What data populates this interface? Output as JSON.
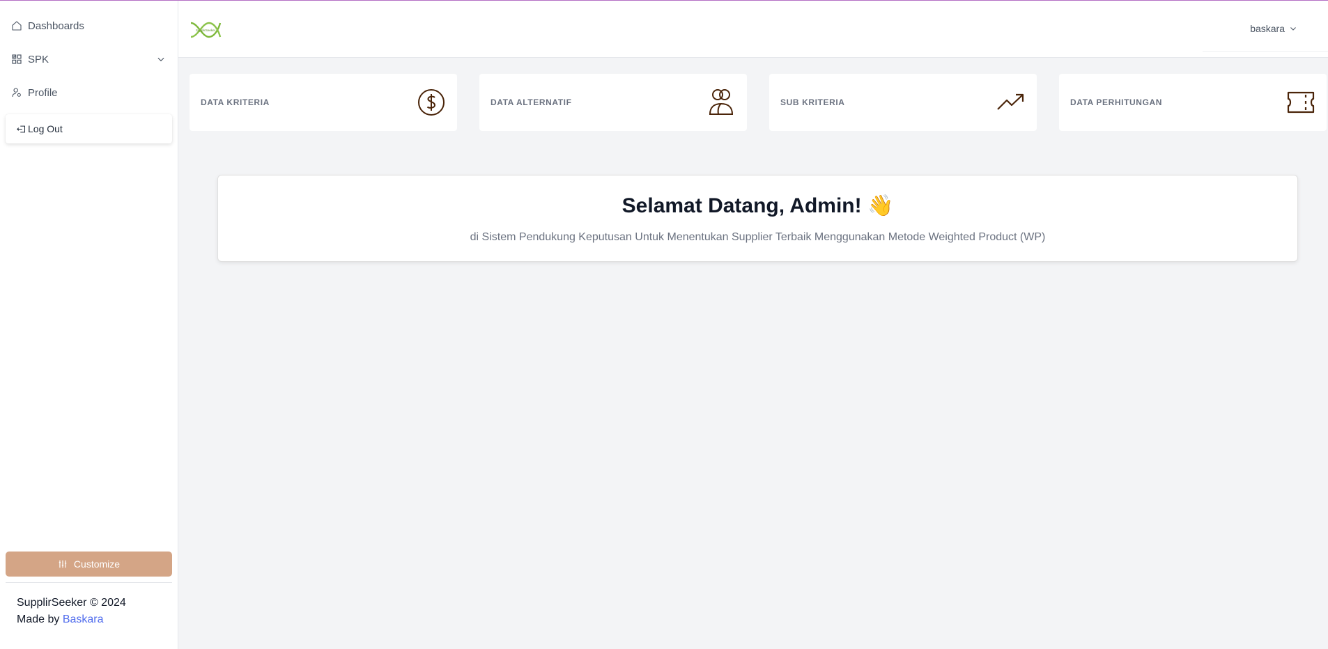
{
  "sidebar": {
    "items": [
      {
        "label": "Dashboards",
        "icon": "home-icon"
      },
      {
        "label": "SPK",
        "icon": "grid-icon"
      },
      {
        "label": "Profile",
        "icon": "user-settings-icon"
      }
    ],
    "logout_label": "Log Out",
    "customize_label": "Customize",
    "footer_line1": "SupplirSeeker © 2024",
    "footer_made_by": "Made by ",
    "footer_author": "Baskara"
  },
  "header": {
    "logo_text": "SupplirSeeker",
    "user_name": "baskara"
  },
  "cards": [
    {
      "label": "DATA KRITERIA",
      "icon": "dollar-circle-icon"
    },
    {
      "label": "DATA ALTERNATIF",
      "icon": "users-icon"
    },
    {
      "label": "SUB KRITERIA",
      "icon": "trending-up-icon"
    },
    {
      "label": "DATA PERHITUNGAN",
      "icon": "ticket-icon"
    }
  ],
  "welcome": {
    "title": "Selamat Datang, Admin! 👋",
    "subtitle": "di Sistem Pendukung Keputusan Untuk Menentukan Supplier Terbaik Menggunakan Metode Weighted Product (WP)"
  },
  "colors": {
    "accent_line": "#b46fc4",
    "customize_button": "#d4a586",
    "link": "#4f6bed",
    "icon_stroke": "#4a2409"
  }
}
